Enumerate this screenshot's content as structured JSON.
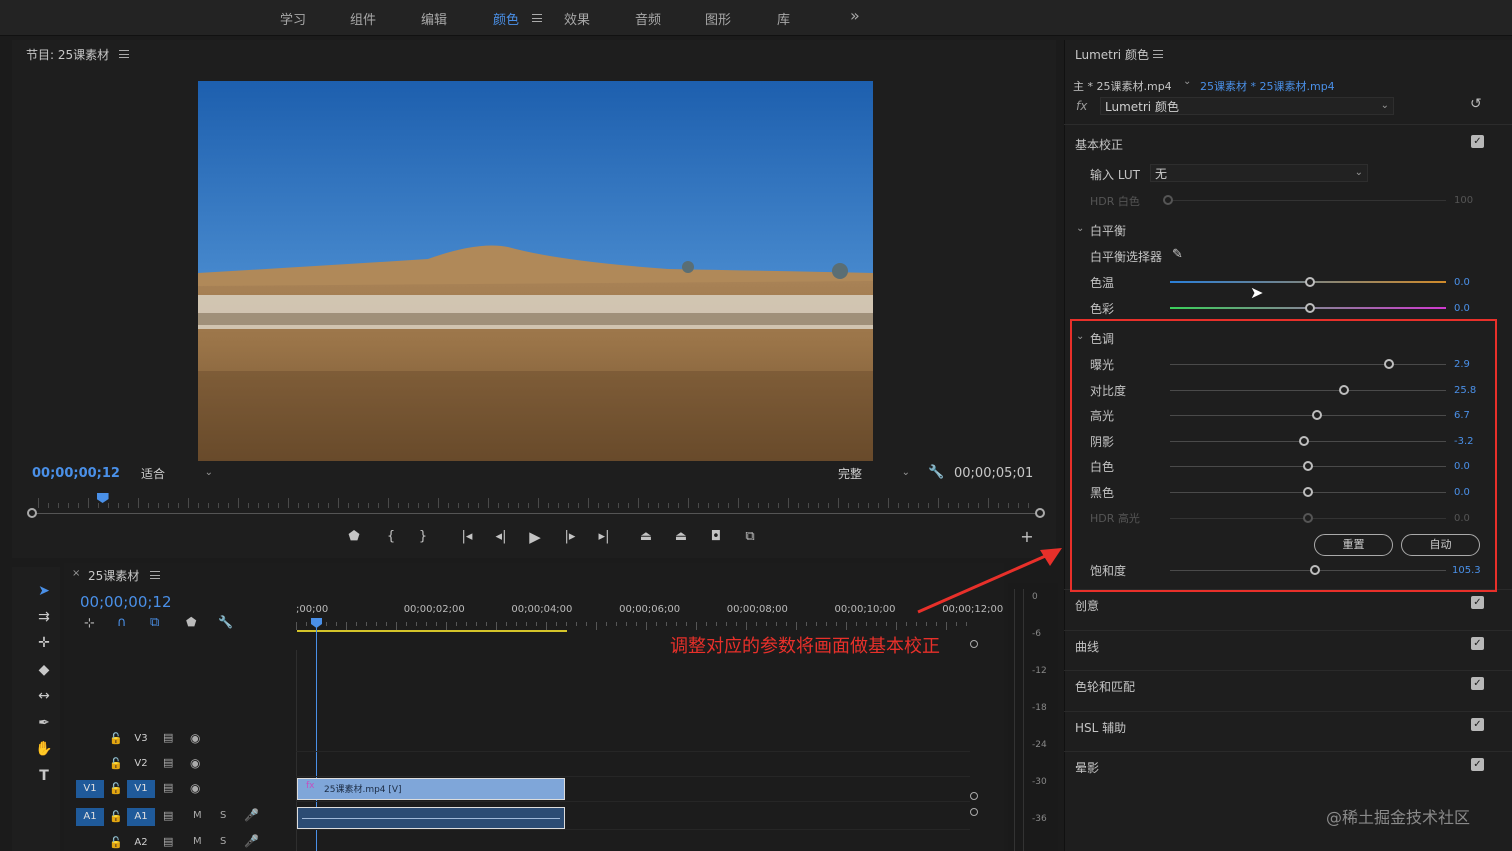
{
  "workspaces": [
    {
      "label": "学习",
      "active": false
    },
    {
      "label": "组件",
      "active": false
    },
    {
      "label": "编辑",
      "active": false
    },
    {
      "label": "颜色",
      "active": true
    },
    {
      "label": "效果",
      "active": false
    },
    {
      "label": "音频",
      "active": false
    },
    {
      "label": "图形",
      "active": false
    },
    {
      "label": "库",
      "active": false
    }
  ],
  "workspaces_overflow": "»",
  "program": {
    "title": "节目: 25课素材",
    "current_time": "00;00;00;12",
    "fit_label": "适合",
    "quality_label": "完整",
    "duration": "00;00;05;01",
    "playhead_fraction": 0.07
  },
  "timeline": {
    "sequence_name": "25课素材",
    "current_time": "00;00;00;12",
    "ruler": [
      ";00;00",
      "00;00;02;00",
      "00;00;04;00",
      "00;00;06;00",
      "00;00;08;00",
      "00;00;10;00",
      "00;00;12;00"
    ],
    "tracks": [
      {
        "id": "V3",
        "type": "video",
        "badge": "V3",
        "source": ""
      },
      {
        "id": "V2",
        "type": "video",
        "badge": "V2",
        "source": ""
      },
      {
        "id": "V1",
        "type": "video",
        "badge": "V1",
        "source": "V1"
      },
      {
        "id": "A1",
        "type": "audio",
        "badge": "A1",
        "source": "A1"
      },
      {
        "id": "A2",
        "type": "audio",
        "badge": "A2",
        "source": ""
      }
    ],
    "clip_label": "25课素材.mp4 [V]",
    "audio_m": "M",
    "audio_s": "S"
  },
  "meter": {
    "db": [
      "0",
      "-6",
      "-12",
      "-18",
      "-24",
      "-30",
      "-36"
    ]
  },
  "lumetri": {
    "title": "Lumetri 颜色",
    "source_master": "主 * 25课素材.mp4",
    "source_clip": "25课素材 * 25课素材.mp4",
    "fx_label": "fx",
    "effect_name": "Lumetri 颜色",
    "basic_section": "基本校正",
    "input_lut_label": "输入 LUT",
    "input_lut_value": "无",
    "hdr_white_label": "HDR 白色",
    "hdr_white_value": "100",
    "white_balance": "白平衡",
    "wb_selector": "白平衡选择器",
    "temp_label": "色温",
    "temp_value": "0.0",
    "tint_label": "色彩",
    "tint_value": "0.0",
    "tone_section": "色调",
    "tone_params": [
      {
        "label": "曝光",
        "value": "2.9",
        "pos": 0.795
      },
      {
        "label": "对比度",
        "value": "25.8",
        "pos": 0.632
      },
      {
        "label": "高光",
        "value": "6.7",
        "pos": 0.534
      },
      {
        "label": "阴影",
        "value": "-3.2",
        "pos": 0.484
      },
      {
        "label": "白色",
        "value": "0.0",
        "pos": 0.5
      },
      {
        "label": "黑色",
        "value": "0.0",
        "pos": 0.5
      },
      {
        "label": "HDR 高光",
        "value": "0.0",
        "pos": 0.5,
        "disabled": true
      }
    ],
    "reset_btn": "重置",
    "auto_btn": "自动",
    "saturation_label": "饱和度",
    "saturation_value": "105.3",
    "saturation_pos": 0.527,
    "sections": [
      "创意",
      "曲线",
      "色轮和匹配",
      "HSL 辅助",
      "晕影"
    ]
  },
  "annotation": "调整对应的参数将画面做基本校正",
  "watermark": "@稀土掘金技术社区",
  "colors": {
    "accent": "#4a90e8",
    "annotation": "#e8302a"
  }
}
